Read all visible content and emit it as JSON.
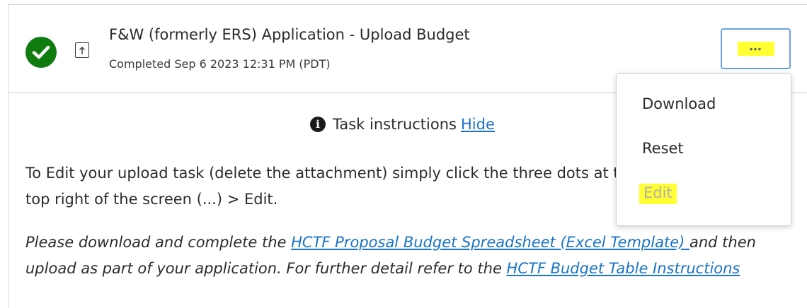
{
  "task": {
    "title": "F&W (formerly ERS) Application - Upload Budget",
    "status": "Completed Sep 6 2023 12:31 PM (PDT)",
    "status_color": "#107c10",
    "status_icon": "check-icon",
    "type_icon": "upload-icon"
  },
  "actions_button": {
    "label": "•••",
    "highlight_color": "#ffff33"
  },
  "menu": {
    "items": [
      {
        "label": "Download"
      },
      {
        "label": "Reset"
      },
      {
        "label": "Edit",
        "highlighted": true
      }
    ]
  },
  "instructions": {
    "toggle_label": "Task instructions",
    "hide_link": "Hide",
    "paragraph1": "To Edit your upload task (delete the attachment) simply click the three dots at the top right of the screen (...) > Edit.",
    "paragraph2": {
      "text1": "Please download and complete the ",
      "link1": "HCTF Proposal Budget Spreadsheet (Excel Template) ",
      "text2": "and then upload as part of your application. For further detail refer to the ",
      "link2": "HCTF Budget Table Instructions"
    }
  },
  "colors": {
    "link": "#1a73c7",
    "focus_border": "#6aa2e0",
    "highlight": "#ffff33"
  }
}
